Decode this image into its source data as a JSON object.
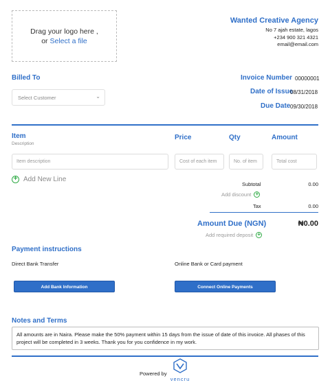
{
  "logo_upload": {
    "text": "Drag your logo here ,",
    "or": "or",
    "link": "Select a file"
  },
  "company": {
    "name": "Wanted Creative Agency",
    "address": "No 7 ajah estate, lagos",
    "phone": "+234 900 321 4321",
    "email": "email@email.com"
  },
  "billed_to": {
    "label": "Billed To",
    "placeholder": "Select Customer"
  },
  "invoice": {
    "number_label": "Invoice Number",
    "number": "00000001",
    "issue_label": "Date of Issue",
    "issue": "08/31/2018",
    "due_label": "Due Date",
    "due": "09/30/2018"
  },
  "columns": {
    "item": "Item",
    "description": "Description",
    "price": "Price",
    "qty": "Qty",
    "amount": "Amount"
  },
  "line_inputs": {
    "item": "Item description",
    "price": "Cost of each item",
    "qty": "No. of item",
    "amount": "Total cost"
  },
  "add_line": "Add New Line",
  "summary": {
    "subtotal_label": "Subtotal",
    "subtotal": "0.00",
    "discount_link": "Add discount",
    "tax_label": "Tax",
    "tax": "0.00",
    "amount_due_label": "Amount Due (NGN)",
    "amount_due": "₦0.00",
    "deposit_link": "Add required deposit"
  },
  "payment": {
    "heading": "Payment instructions",
    "bank_label": "Direct Bank Transfer",
    "online_label": "Online Bank or Card payment",
    "bank_button": "Add Bank Information",
    "online_button": "Connect Online Payments"
  },
  "notes": {
    "heading": "Notes and Terms",
    "text": "All amounts are in Naira. Please make the 50% payment within 15 days from the issue of date of this invoice. All phases of this project will be completed in 3 weeks. Thank you for you confidence in my work."
  },
  "footer": {
    "powered_by": "Powered by",
    "brand": "vencru"
  },
  "colors": {
    "accent": "#2f6fc8",
    "add": "#2eaa44"
  }
}
